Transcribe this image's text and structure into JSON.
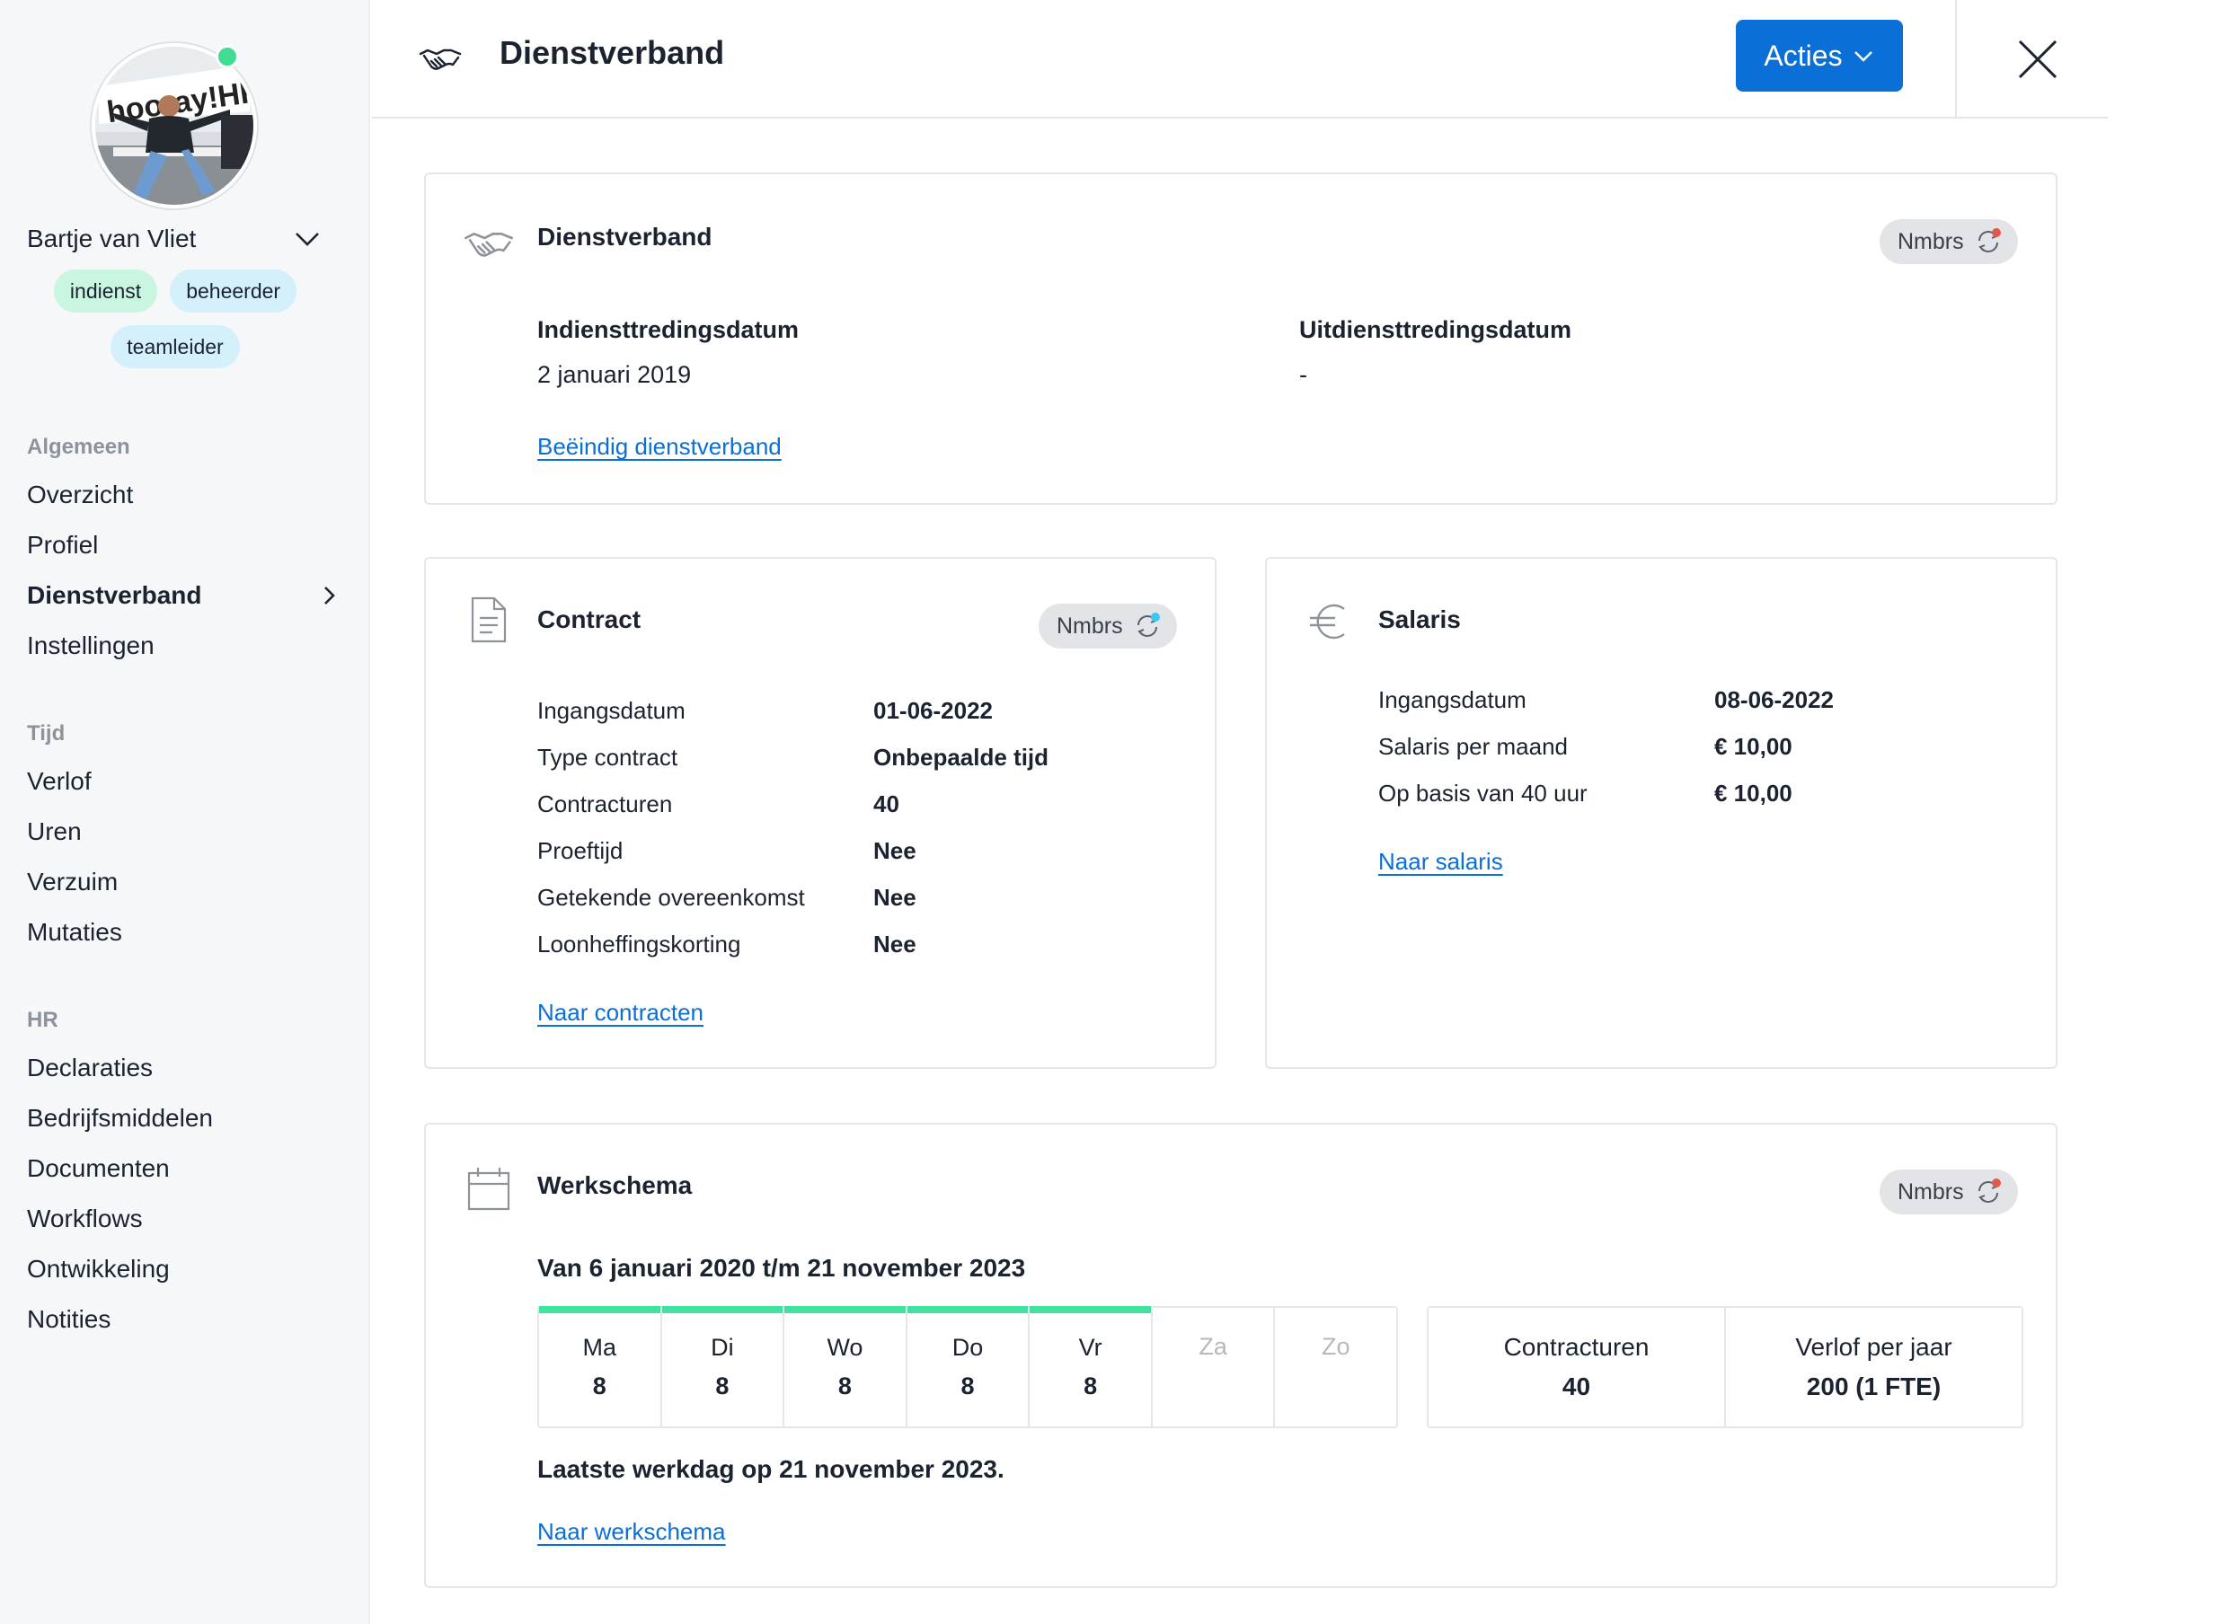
{
  "sidebar": {
    "user": {
      "name": "Bartje van Vliet",
      "status_color": "#3fdc93"
    },
    "tags": [
      "indienst",
      "beheerder",
      "teamleider"
    ],
    "sections": [
      {
        "heading": "Algemeen",
        "items": [
          "Overzicht",
          "Profiel",
          "Dienstverband",
          "Instellingen"
        ]
      },
      {
        "heading": "Tijd",
        "items": [
          "Verlof",
          "Uren",
          "Verzuim",
          "Mutaties"
        ]
      },
      {
        "heading": "HR",
        "items": [
          "Declaraties",
          "Bedrijfsmiddelen",
          "Documenten",
          "Workflows",
          "Ontwikkeling",
          "Notities"
        ]
      }
    ],
    "active_item": "Dienstverband"
  },
  "header": {
    "title": "Dienstverband",
    "icon": "handshake-icon",
    "actions_label": "Acties",
    "accent_color": "#0a6fd6"
  },
  "employment": {
    "title": "Dienstverband",
    "badge": "Nmbrs",
    "start_label": "Indiensttredingsdatum",
    "start_value": "2 januari 2019",
    "end_label": "Uitdiensttredingsdatum",
    "end_value": "-",
    "link": "Beëindig dienstverband"
  },
  "contract": {
    "title": "Contract",
    "badge": "Nmbrs",
    "rows": [
      {
        "label": "Ingangsdatum",
        "value": "01-06-2022"
      },
      {
        "label": "Type contract",
        "value": "Onbepaalde tijd"
      },
      {
        "label": "Contracturen",
        "value": "40"
      },
      {
        "label": "Proeftijd",
        "value": "Nee"
      },
      {
        "label": "Getekende overeenkomst",
        "value": "Nee"
      },
      {
        "label": "Loonheffingskorting",
        "value": "Nee"
      }
    ],
    "link": "Naar contracten"
  },
  "salary": {
    "title": "Salaris",
    "rows": [
      {
        "label": "Ingangsdatum",
        "value": "08-06-2022"
      },
      {
        "label": "Salaris per maand",
        "value": "€ 10,00"
      },
      {
        "label": "Op basis van 40 uur",
        "value": "€ 10,00"
      }
    ],
    "link": "Naar salaris"
  },
  "schedule": {
    "title": "Werkschema",
    "badge": "Nmbrs",
    "period": "Van 6 januari 2020 t/m 21 november 2023",
    "days": [
      {
        "name": "Ma",
        "hours": "8"
      },
      {
        "name": "Di",
        "hours": "8"
      },
      {
        "name": "Wo",
        "hours": "8"
      },
      {
        "name": "Do",
        "hours": "8"
      },
      {
        "name": "Vr",
        "hours": "8"
      },
      {
        "name": "Za",
        "hours": ""
      },
      {
        "name": "Zo",
        "hours": ""
      }
    ],
    "stats": [
      {
        "label": "Contracturen",
        "value": "40"
      },
      {
        "label": "Verlof per jaar",
        "value": "200 (1 FTE)"
      }
    ],
    "last_workday": "Laatste werkdag op 21 november 2023.",
    "link": "Naar werkschema",
    "work_day_color": "#3fe3a0"
  }
}
